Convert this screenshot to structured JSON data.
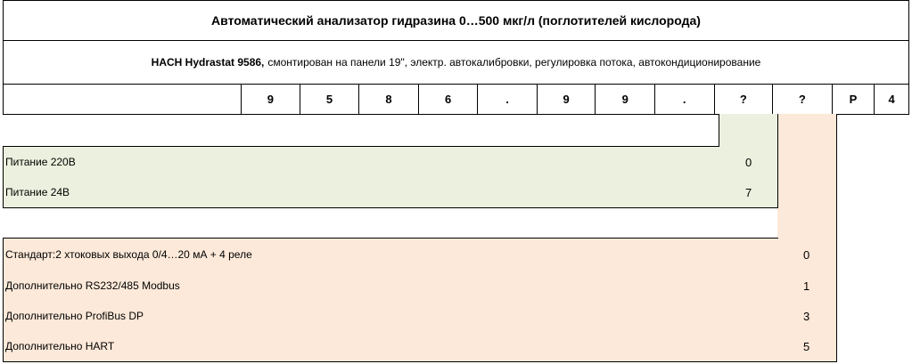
{
  "title": "Автоматический анализатор гидразина 0…500 мкг/л (поглотителей кислорода)",
  "description": {
    "model": "HACH Hydrastat 9586,",
    "rest": "смонтирован на панели 19\", электр. автокалибровки, регулировка потока, автокондиционирование"
  },
  "code_cells": [
    "",
    "9",
    "5",
    "8",
    "6",
    ".",
    "9",
    "9",
    ".",
    "?",
    "?",
    "P",
    "4"
  ],
  "power_options": [
    {
      "label": "Питание 220В",
      "code": "0"
    },
    {
      "label": "Питание 24В",
      "code": "7"
    }
  ],
  "output_options": [
    {
      "label": "Стандарт:2 хтоковых выхода 0/4…20 мА + 4 реле",
      "code": "0"
    },
    {
      "label": "Дополнительно RS232/485 Modbus",
      "code": "1"
    },
    {
      "label": "Дополнительно ProfiBus DP",
      "code": "3"
    },
    {
      "label": "Дополнительно HART",
      "code": "5"
    }
  ],
  "colors": {
    "power_group": "#ebf1de",
    "output_group": "#fde9d9",
    "border": "#000000"
  }
}
